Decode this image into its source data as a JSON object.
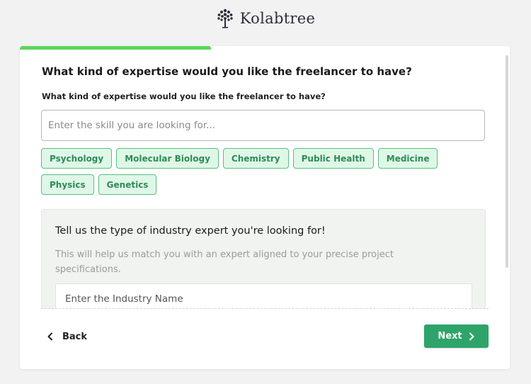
{
  "brand": {
    "name": "Kolabtree",
    "icon": "tree-logo-icon"
  },
  "progress": {
    "fraction": 0.39,
    "color": "#5cd65c"
  },
  "expertise": {
    "title": "What kind of expertise would you like the freelancer to have?",
    "subtitle": "What kind of expertise would you like the freelancer to have?",
    "input_value": "",
    "placeholder": "Enter the skill you are looking for...",
    "chips": [
      "Psychology",
      "Molecular Biology",
      "Chemistry",
      "Public Health",
      "Medicine",
      "Physics",
      "Genetics"
    ]
  },
  "industry": {
    "title": "Tell us the type of industry expert you're looking for!",
    "description": "This will help us match you with an expert aligned to your precise project specifications.",
    "input_value": "",
    "placeholder": "Enter the Industry Name"
  },
  "footer": {
    "back_label": "Back",
    "back_icon": "chevron-left-icon",
    "next_label": "Next",
    "next_icon": "chevron-right-icon"
  },
  "colors": {
    "accent": "#2ea46a",
    "chip_bg": "#dff7e7",
    "chip_border": "#57c07f",
    "chip_text": "#2e8b57"
  }
}
